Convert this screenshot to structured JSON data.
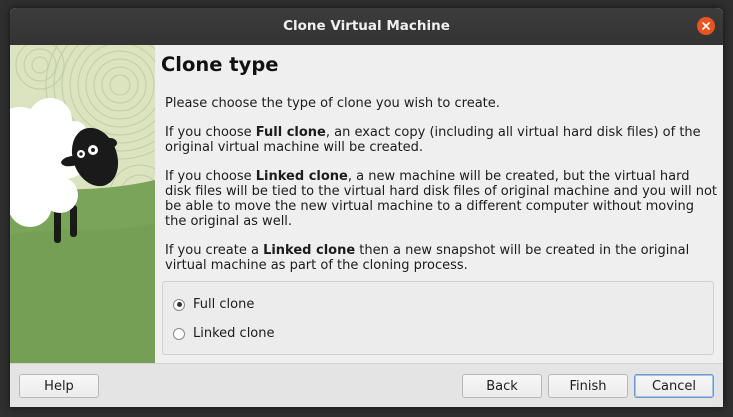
{
  "window": {
    "title": "Clone Virtual Machine"
  },
  "page": {
    "heading": "Clone type",
    "intro": "Please choose the type of clone you wish to create.",
    "full_clone_para": {
      "prefix": "If you choose ",
      "bold": "Full clone",
      "suffix": ", an exact copy (including all virtual hard disk files) of the original virtual machine will be created."
    },
    "linked_clone_para": {
      "prefix": "If you choose ",
      "bold": "Linked clone",
      "suffix": ", a new machine will be created, but the virtual hard disk files will be tied to the virtual hard disk files of original machine and you will not be able to move the new virtual machine to a different computer without moving the original as well."
    },
    "snapshot_para": {
      "prefix": "If you create a ",
      "bold": "Linked clone",
      "suffix": " then a new snapshot will be created in the original virtual machine as part of the cloning process."
    }
  },
  "options": {
    "selected": "full_clone",
    "full_clone_label": "Full clone",
    "linked_clone_label": "Linked clone"
  },
  "buttons": {
    "help": "Help",
    "back": "Back",
    "finish": "Finish",
    "cancel": "Cancel"
  },
  "icons": {
    "close": "close-icon",
    "illustration": "sheep-illustration"
  },
  "colors": {
    "accent_close": "#e95420",
    "art_green": "#7aa45a",
    "art_light_green": "#dbe3c0"
  }
}
